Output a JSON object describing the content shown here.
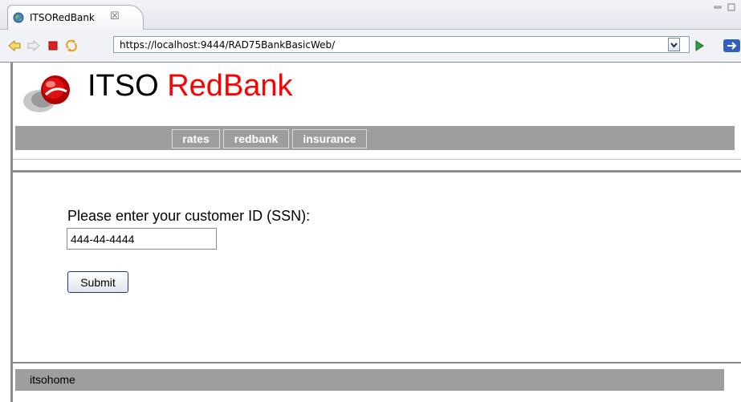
{
  "tab": {
    "title": "ITSORedBank"
  },
  "toolbar": {
    "url": "https://localhost:9444/RAD75BankBasicWeb/"
  },
  "brand": {
    "part1": "ITSO ",
    "part2": "RedBank"
  },
  "nav": {
    "items": [
      {
        "label": "rates"
      },
      {
        "label": "redbank"
      },
      {
        "label": "insurance"
      }
    ]
  },
  "form": {
    "prompt": "Please enter your customer ID (SSN):",
    "ssn_value": "444-44-4444",
    "submit_label": "Submit"
  },
  "footer": {
    "link": "itsohome"
  },
  "colors": {
    "brand_red": "#ff0000",
    "nav_gray": "#9e9e9e"
  }
}
